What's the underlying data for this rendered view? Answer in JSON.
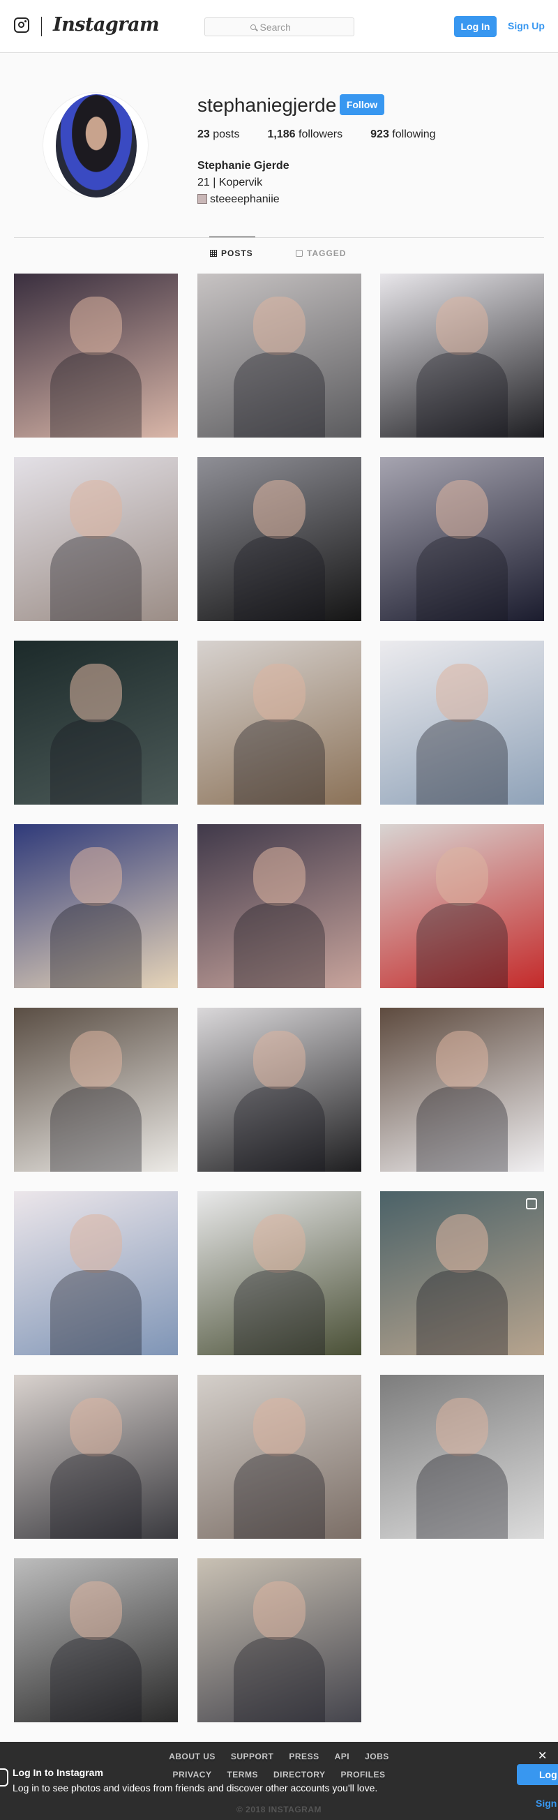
{
  "nav": {
    "wordmark": "Instagram",
    "search_placeholder": "Search",
    "login_label": "Log In",
    "signup_label": "Sign Up"
  },
  "profile": {
    "username": "stephaniegjerde",
    "follow_label": "Follow",
    "stats": [
      {
        "value": "23",
        "label": "posts"
      },
      {
        "value": "1,186",
        "label": "followers"
      },
      {
        "value": "923",
        "label": "following"
      }
    ],
    "full_name": "Stephanie Gjerde",
    "bio_line": "21 | Kopervik",
    "snapchat": "steeeephaniie"
  },
  "tabs": [
    {
      "label": "POSTS",
      "icon": "grid-icon",
      "active": true
    },
    {
      "label": "TAGGED",
      "icon": "tag-icon",
      "active": false
    }
  ],
  "posts": [
    {
      "colors": [
        "#3a2f3f",
        "#d9b6a8"
      ]
    },
    {
      "colors": [
        "#c7c3c3",
        "#5b5b5e"
      ]
    },
    {
      "colors": [
        "#e8e6ea",
        "#1e1e22"
      ]
    },
    {
      "colors": [
        "#e3e0e6",
        "#9b8d86"
      ]
    },
    {
      "colors": [
        "#8f8f96",
        "#151515"
      ]
    },
    {
      "colors": [
        "#a6a4b0",
        "#1b1c2e"
      ]
    },
    {
      "colors": [
        "#1c2a2a",
        "#4c5a58"
      ]
    },
    {
      "colors": [
        "#d7d2cf",
        "#8b7258"
      ]
    },
    {
      "colors": [
        "#ecebee",
        "#8fa2b8"
      ]
    },
    {
      "colors": [
        "#2f3a7a",
        "#e6d4b8"
      ]
    },
    {
      "colors": [
        "#40394a",
        "#c8a49c"
      ]
    },
    {
      "colors": [
        "#d8d4d2",
        "#c42a2a"
      ]
    },
    {
      "colors": [
        "#5a4e44",
        "#eceae6"
      ]
    },
    {
      "colors": [
        "#dad8da",
        "#1e1e20"
      ]
    },
    {
      "colors": [
        "#5e4b3f",
        "#f1f0f2"
      ]
    },
    {
      "colors": [
        "#ece6ea",
        "#7f95b6"
      ]
    },
    {
      "colors": [
        "#e9e9ea",
        "#4a5036"
      ]
    },
    {
      "colors": [
        "#4b6268",
        "#b7a48e"
      ],
      "carousel": true
    },
    {
      "colors": [
        "#d9d2ce",
        "#3a3a3f"
      ]
    },
    {
      "colors": [
        "#d4cfca",
        "#7b6e66"
      ]
    },
    {
      "colors": [
        "#7d7d7d",
        "#dcdcdc"
      ]
    },
    {
      "colors": [
        "#bdbdbd",
        "#2a2a2a"
      ]
    },
    {
      "colors": [
        "#c9c1b4",
        "#44444c"
      ]
    }
  ],
  "footer": {
    "row1": [
      "ABOUT US",
      "SUPPORT",
      "PRESS",
      "API",
      "JOBS"
    ],
    "row2": [
      "PRIVACY",
      "TERMS",
      "DIRECTORY",
      "PROFILES"
    ],
    "copyright": "© 2018 INSTAGRAM"
  },
  "banner": {
    "title": "Log In to Instagram",
    "text": "Log in to see photos and videos from friends and discover other accounts you'll love.",
    "login_label": "Log",
    "signup_label": "Sign",
    "close": "✕"
  }
}
